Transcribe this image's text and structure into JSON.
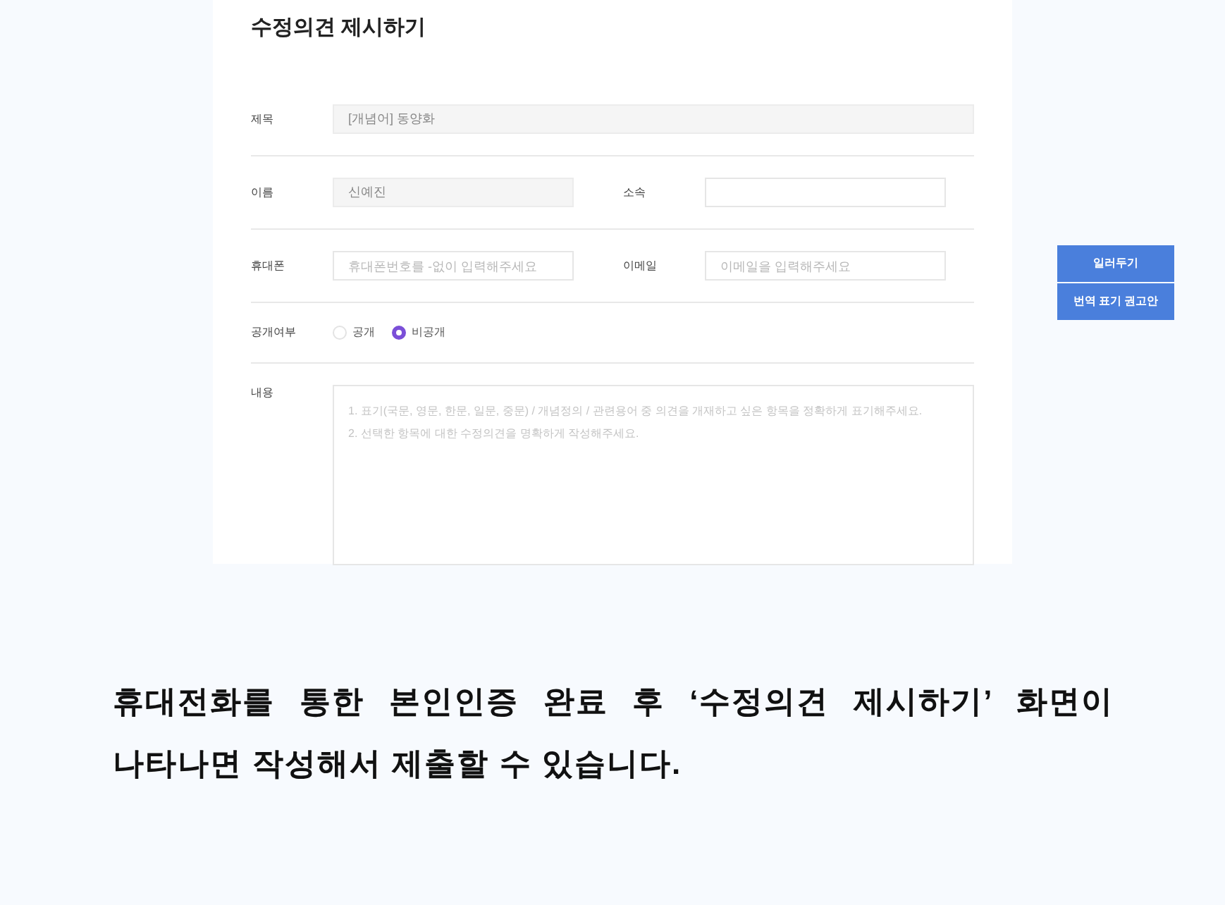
{
  "form": {
    "title": "수정의견 제시하기",
    "rows": [
      {
        "kind": "single",
        "label": "제목",
        "field": {
          "value": "[개념어] 동양화",
          "disabled": true
        }
      },
      {
        "kind": "pair",
        "label": "이름",
        "field": {
          "value": "신예진",
          "disabled": true
        },
        "label2": "소속",
        "field2": {}
      },
      {
        "kind": "pair",
        "label": "휴대폰",
        "field": {
          "placeholder": "휴대폰번호를 -없이 입력해주세요"
        },
        "label2": "이메일",
        "field2": {
          "placeholder": "이메일을 입력해주세요"
        }
      },
      {
        "kind": "radio",
        "label": "공개여부",
        "options": [
          {
            "label": "공개",
            "selected": false
          },
          {
            "label": "비공개",
            "selected": true
          }
        ]
      },
      {
        "kind": "textarea",
        "label": "내용",
        "placeholder": "1. 표기(국문, 영문, 한문, 일문, 중문) / 개념정의 / 관련용어 중 의견을 개재하고 싶은 항목을 정확하게 표기해주세요.\n2. 선택한 항목에 대한 수정의견을 명확하게 작성해주세요."
      }
    ]
  },
  "side_buttons": [
    {
      "label": "일러두기"
    },
    {
      "label": "번역 표기 권고안"
    }
  ],
  "caption": "휴대전화를 통한 본인인증 완료 후 ‘수정의견 제시하기’ 화면이 나타나면 작성해서 제출할 수 있습니다."
}
